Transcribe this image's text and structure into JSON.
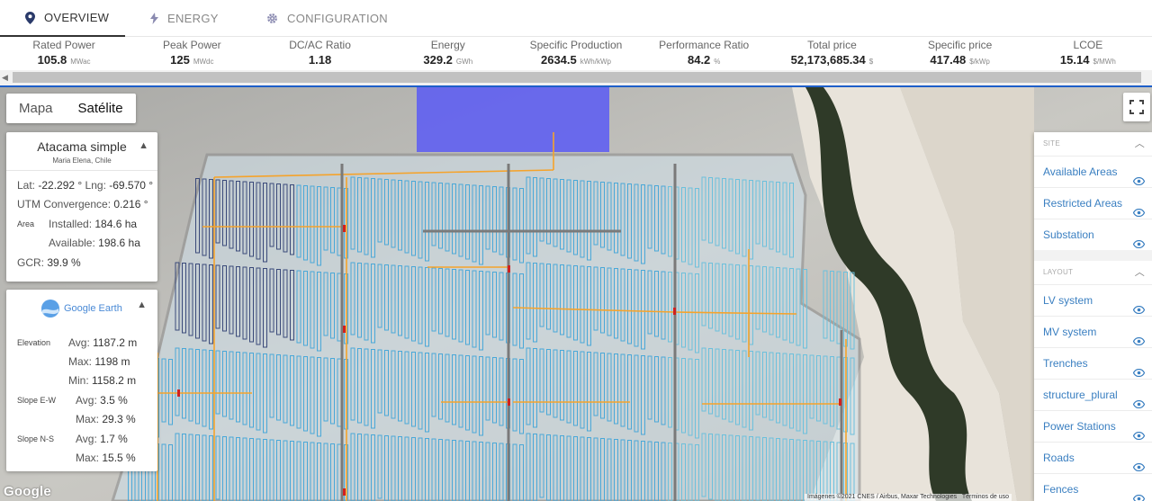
{
  "tabs": [
    {
      "label": "OVERVIEW",
      "icon": "location-pin-icon",
      "active": true
    },
    {
      "label": "ENERGY",
      "icon": "lightning-bolt-icon",
      "active": false
    },
    {
      "label": "CONFIGURATION",
      "icon": "gear-icon",
      "active": false
    }
  ],
  "kpis": [
    {
      "label": "Rated Power",
      "value": "105.8",
      "unit": "MWac"
    },
    {
      "label": "Peak Power",
      "value": "125",
      "unit": "MWdc"
    },
    {
      "label": "DC/AC Ratio",
      "value": "1.18",
      "unit": ""
    },
    {
      "label": "Energy",
      "value": "329.2",
      "unit": "GWh"
    },
    {
      "label": "Specific Production",
      "value": "2634.5",
      "unit": "kWh/kWp"
    },
    {
      "label": "Performance Ratio",
      "value": "84.2",
      "unit": "%"
    },
    {
      "label": "Total price",
      "value": "52,173,685.34",
      "unit": "$"
    },
    {
      "label": "Specific price",
      "value": "417.48",
      "unit": "$/kWp"
    },
    {
      "label": "LCOE",
      "value": "15.14",
      "unit": "$/MWh"
    }
  ],
  "map_type": {
    "map_label": "Mapa",
    "satellite_label": "Satélite",
    "selected": "Satélite"
  },
  "site_info": {
    "name": "Atacama simple",
    "location": "Maria Elena, Chile",
    "lat_label": "Lat:",
    "lat": "-22.292 °",
    "lng_label": "Lng:",
    "lng": "-69.570 °",
    "utm_label": "UTM Convergence:",
    "utm": "0.216 °",
    "area_label": "Area",
    "installed_label": "Installed:",
    "installed": "184.6 ha",
    "available_label": "Available:",
    "available": "198.6 ha",
    "gcr_label": "GCR:",
    "gcr": "39.9 %"
  },
  "google_earth": {
    "logo_text": "Google Earth",
    "elevation_label": "Elevation",
    "avg_label": "Avg:",
    "max_label": "Max:",
    "min_label": "Min:",
    "elev_avg": "1187.2 m",
    "elev_max": "1198 m",
    "elev_min": "1158.2 m",
    "slope_ew_label": "Slope E-W",
    "slope_ew_avg": "3.5 %",
    "slope_ew_max": "29.3 %",
    "slope_ns_label": "Slope N-S",
    "slope_ns_avg": "1.7 %",
    "slope_ns_max": "15.5 %"
  },
  "layers": {
    "site_header": "SITE",
    "site_items": [
      "Available Areas",
      "Restricted Areas",
      "Substation"
    ],
    "layout_header": "LAYOUT",
    "layout_items": [
      "LV system",
      "MV system",
      "Trenches",
      "structure_plural",
      "Power Stations",
      "Roads",
      "Fences"
    ]
  },
  "map_footer": {
    "google_logo": "Google",
    "attribution": "Imágenes ©2021 CNES / Airbus, Maxar Technologies",
    "terms": "Términos de uso"
  },
  "colors": {
    "accent": "#1e5fc9",
    "link": "#3a7fc1",
    "substation": "#5a5af5",
    "structures": "#4aa8d8",
    "mv_cable": "#f5a32b",
    "roads": "#7a7a7a"
  }
}
